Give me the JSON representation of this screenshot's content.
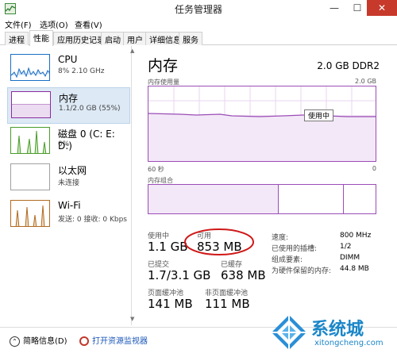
{
  "window": {
    "title": "任务管理器",
    "minimize": "—",
    "maximize": "☐",
    "close": "✕"
  },
  "menu": [
    "文件(F)",
    "选项(O)",
    "查看(V)"
  ],
  "tabs": [
    "进程",
    "性能",
    "应用历史记录",
    "启动",
    "用户",
    "详细信息",
    "服务"
  ],
  "sidebar": [
    {
      "title": "CPU",
      "sub": "8% 2.10 GHz",
      "color": "#1a6ec1"
    },
    {
      "title": "内存",
      "sub": "1.1/2.0 GB (55%)",
      "color": "#8b2c9e"
    },
    {
      "title": "磁盘 0 (C: E: D:)",
      "sub": "0%",
      "color": "#4a9c2a"
    },
    {
      "title": "以太网",
      "sub": "未连接",
      "color": "#a0a0a0"
    },
    {
      "title": "Wi-Fi",
      "sub": "发送: 0 接收: 0 Kbps",
      "color": "#b06a20"
    }
  ],
  "memory": {
    "title": "内存",
    "capacity": "2.0 GB DDR2",
    "usage_label": "内存使用量",
    "usage_max": "2.0 GB",
    "in_use_tag": "使用中",
    "time_left": "60 秒",
    "time_right": "0",
    "composition_label": "内存组合",
    "in_use_label": "使用中",
    "in_use_value": "1.1 GB",
    "available_label": "可用",
    "available_value": "853 MB",
    "committed_label": "已提交",
    "committed_value": "1.7/3.1 GB",
    "cached_label": "已缓存",
    "cached_value": "638 MB",
    "paged_label": "页面缓冲池",
    "paged_value": "141 MB",
    "nonpaged_label": "非页面缓冲池",
    "nonpaged_value": "111 MB",
    "details": [
      {
        "label": "速度:",
        "value": "800 MHz"
      },
      {
        "label": "已使用的插槽:",
        "value": "1/2"
      },
      {
        "label": "组成要素:",
        "value": "DIMM"
      },
      {
        "label": "为硬件保留的内存:",
        "value": "44.8 MB"
      }
    ]
  },
  "footer": {
    "fewer_details": "简略信息(D)",
    "open_monitor": "打开资源监视器"
  },
  "watermark": {
    "brand": "系统城",
    "url": "xitongcheng.com"
  },
  "colors": {
    "memory_accent": "#9b4db7",
    "annotation_circle": "#d01818",
    "close_button": "#c7392b"
  }
}
